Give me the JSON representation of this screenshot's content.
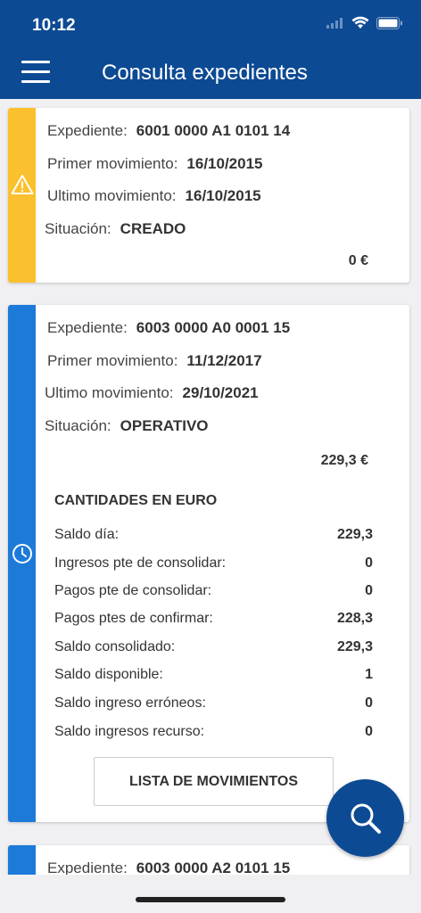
{
  "status_bar": {
    "time": "10:12"
  },
  "header": {
    "title": "Consulta expedientes"
  },
  "colors": {
    "header": "#0d4a94",
    "warning_bar": "#fbc02d",
    "active_bar": "#1e7ad8"
  },
  "labels": {
    "expediente": "Expediente:",
    "primer": "Primer movimiento:",
    "ultimo": "Ultimo movimiento:",
    "situacion": "Situación:"
  },
  "cards": [
    {
      "status_icon": "warning-icon",
      "expediente": "6001 0000 A1 0101 14",
      "primer": "16/10/2015",
      "ultimo": "16/10/2015",
      "situacion": "CREADO",
      "amount": "0 €"
    },
    {
      "status_icon": "clock-icon",
      "expediente": "6003 0000 A0 0001 15",
      "primer": "11/12/2017",
      "ultimo": "29/10/2021",
      "situacion": "OPERATIVO",
      "amount": "229,3 €",
      "section_title": "CANTIDADES EN EURO",
      "amounts": [
        {
          "label": "Saldo día:",
          "value": "229,3"
        },
        {
          "label": "Ingresos pte de consolidar:",
          "value": "0"
        },
        {
          "label": "Pagos pte de consolidar:",
          "value": "0"
        },
        {
          "label": "Pagos ptes de confirmar:",
          "value": "228,3"
        },
        {
          "label": "Saldo consolidado:",
          "value": "229,3"
        },
        {
          "label": "Saldo disponible:",
          "value": "1"
        },
        {
          "label": "Saldo ingreso erróneos:",
          "value": "0"
        },
        {
          "label": "Saldo ingresos recurso:",
          "value": "0"
        }
      ],
      "button_label": "LISTA DE MOVIMIENTOS"
    },
    {
      "expediente": "6003 0000 A2 0101 15"
    }
  ],
  "fab": {
    "icon": "search-icon"
  }
}
